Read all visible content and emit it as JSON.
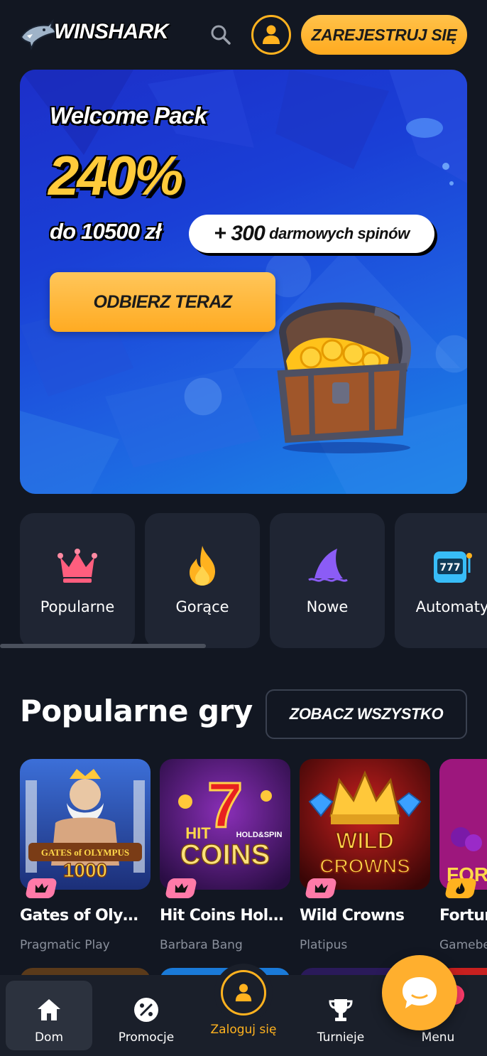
{
  "header": {
    "brand": "WINSHARK",
    "register_label": "ZAREJESTRUJ SIĘ"
  },
  "banner": {
    "welcome": "Welcome Pack",
    "percent": "240%",
    "upto": "do 10500 zł",
    "spins_num": "+ 300",
    "spins_text": "darmowych spinów",
    "cta": "ODBIERZ TERAZ"
  },
  "categories": [
    {
      "label": "Popularne",
      "icon": "crown-icon",
      "color": "#ff5e7e"
    },
    {
      "label": "Gorące",
      "icon": "fire-icon",
      "color": "#ffb21f"
    },
    {
      "label": "Nowe",
      "icon": "shark-fin-icon",
      "color": "#8b5cf6"
    },
    {
      "label": "Automaty",
      "icon": "slot-machine-icon",
      "color": "#38bdf8"
    }
  ],
  "popular": {
    "title": "Popularne gry",
    "see_all": "ZOBACZ WSZYSTKO",
    "games": [
      {
        "title": "Gates of Olymp...",
        "provider": "Pragmatic Play",
        "badge": "crown-icon",
        "badge_color": "#ff7aa8"
      },
      {
        "title": "Hit Coins Hold ...",
        "provider": "Barbara Bang",
        "badge": "crown-icon",
        "badge_color": "#ff7aa8"
      },
      {
        "title": "Wild Crowns",
        "provider": "Platipus",
        "badge": "crown-icon",
        "badge_color": "#ff7aa8"
      },
      {
        "title": "Fortun",
        "provider": "Gamebe",
        "badge": "fire-icon",
        "badge_color": "#ffb21f"
      }
    ]
  },
  "nav": {
    "home": "Dom",
    "promotions": "Promocje",
    "login": "Zaloguj się",
    "tournaments": "Turnieje",
    "menu": "Menu"
  },
  "colors": {
    "accent": "#ffb21f",
    "background": "#121722",
    "card": "#1f2533"
  }
}
